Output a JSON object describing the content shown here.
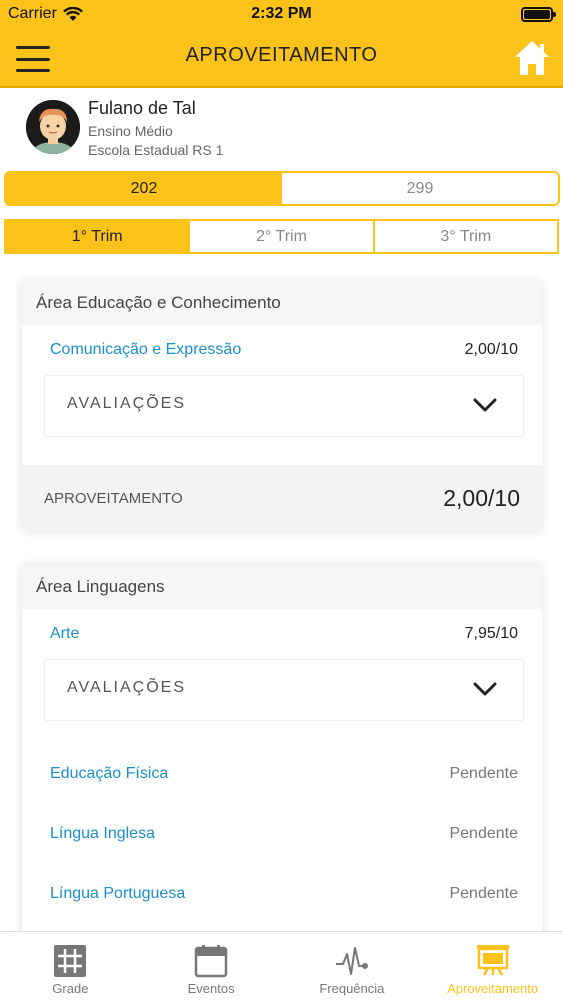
{
  "status": {
    "carrier": "Carrier",
    "time": "2:32 PM"
  },
  "header": {
    "title": "APROVEITAMENTO"
  },
  "student": {
    "name": "Fulano de Tal",
    "level": "Ensino Médio",
    "school": "Escola Estadual RS 1"
  },
  "year_tabs": {
    "items": [
      "202",
      "299"
    ],
    "selected": "202"
  },
  "term_tabs": {
    "items": [
      "1° Trim",
      "2° Trim",
      "3° Trim"
    ],
    "selected": "1° Trim"
  },
  "areas": [
    {
      "title": "Área Educação e Conhecimento",
      "subjects": [
        {
          "name": "Comunicação e Expressão",
          "grade": "2,00/10",
          "evaluations_label": "AVALIAÇÕES"
        }
      ],
      "summary": {
        "label": "APROVEITAMENTO",
        "value": "2,00/10"
      }
    },
    {
      "title": "Área Linguagens",
      "subjects": [
        {
          "name": "Arte",
          "grade": "7,95/10",
          "evaluations_label": "AVALIAÇÕES"
        },
        {
          "name": "Educação Física",
          "grade": "Pendente"
        },
        {
          "name": "Língua Inglesa",
          "grade": "Pendente"
        },
        {
          "name": "Língua Portuguesa",
          "grade": "Pendente"
        }
      ]
    }
  ],
  "tabbar": {
    "items": [
      {
        "label": "Grade",
        "icon": "grid-icon"
      },
      {
        "label": "Eventos",
        "icon": "calendar-icon"
      },
      {
        "label": "Frequência",
        "icon": "pulse-icon"
      },
      {
        "label": "Aproveitamento",
        "icon": "presentation-board-icon"
      }
    ],
    "selected": "Aproveitamento"
  },
  "colors": {
    "accent": "#fbc31a",
    "link": "#1a8fc9",
    "tab_inactive": "#777777"
  }
}
